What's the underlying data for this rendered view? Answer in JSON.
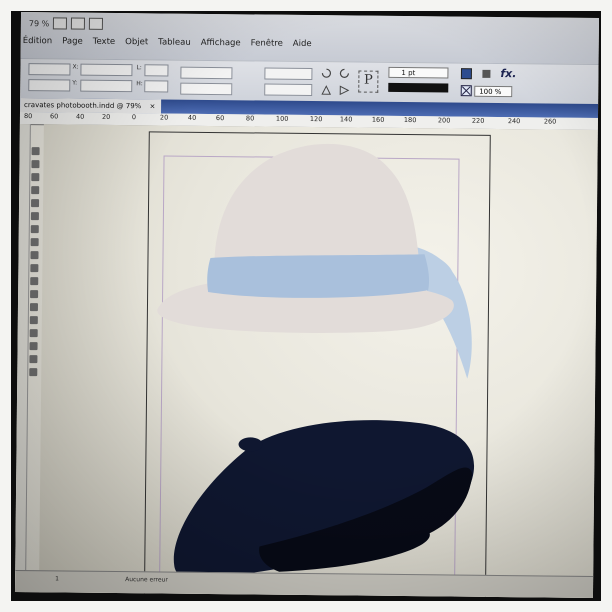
{
  "topbar": {
    "zoom": "79 %"
  },
  "menu": [
    "Édition",
    "Page",
    "Texte",
    "Objet",
    "Tableau",
    "Affichage",
    "Fenêtre",
    "Aide"
  ],
  "controls": {
    "x_label": "X:",
    "y_label": "Y:",
    "w_label": "L:",
    "h_label": "H:",
    "stroke_weight": "1 pt",
    "zoom_percent": "100 %",
    "paragraph_icon": "P",
    "fx_label": "fx."
  },
  "document": {
    "tab_title": "cravates photobooth.indd @ 79%",
    "close": "×"
  },
  "ruler": {
    "ticks": [
      "80",
      "60",
      "40",
      "20",
      "0",
      "20",
      "40",
      "60",
      "80",
      "100",
      "120",
      "140",
      "160",
      "180",
      "200",
      "220",
      "240",
      "260"
    ]
  },
  "status": {
    "page": "1",
    "state": "Aucune erreur"
  },
  "artwork": {
    "hat_color": "#e2dcd9",
    "band_color": "#a9c0dc",
    "ribbon_color": "#bccfe4",
    "beret_color": "#0f1730",
    "beret_shadow": "#070a16"
  }
}
